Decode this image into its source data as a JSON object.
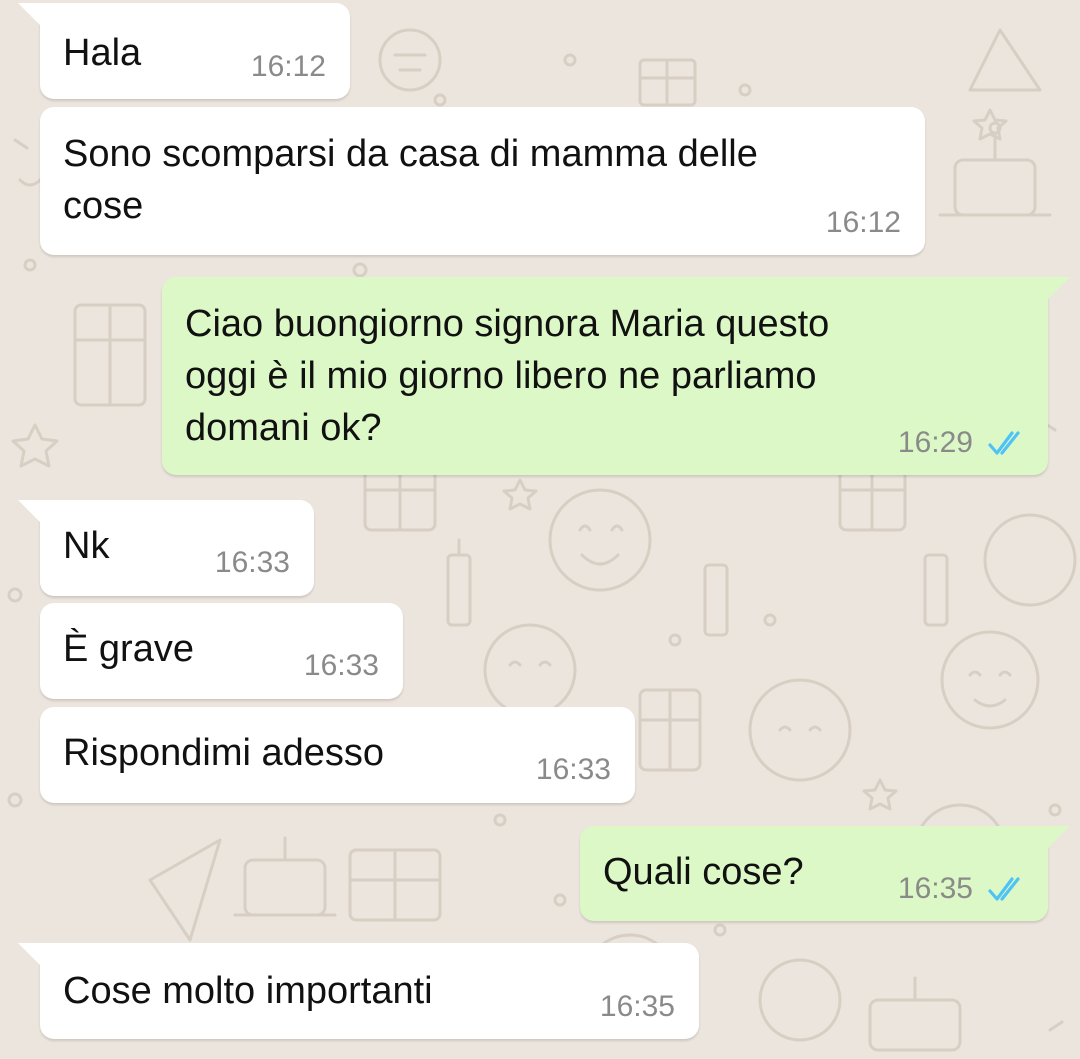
{
  "theme": {
    "incoming_bg": "#ffffff",
    "outgoing_bg": "#dcf8c6",
    "chat_bg": "#ece5dd",
    "read_tick_color": "#4fc3f7"
  },
  "messages": [
    {
      "direction": "incoming",
      "text": "Hala",
      "time": "16:12"
    },
    {
      "direction": "incoming",
      "text": "Sono scomparsi da casa di mamma delle\ncose",
      "time": "16:12"
    },
    {
      "direction": "outgoing",
      "text": "Ciao buongiorno signora Maria questo\noggi è il mio giorno libero ne parliamo\ndomani ok?",
      "time": "16:29",
      "status": "read",
      "status_icon": "double-check-icon"
    },
    {
      "direction": "incoming",
      "text": "Nk",
      "time": "16:33"
    },
    {
      "direction": "incoming",
      "text": "È grave",
      "time": "16:33"
    },
    {
      "direction": "incoming",
      "text": "Rispondimi adesso",
      "time": "16:33"
    },
    {
      "direction": "outgoing",
      "text": "Quali cose?",
      "time": "16:35",
      "status": "read",
      "status_icon": "double-check-icon"
    },
    {
      "direction": "incoming",
      "text": "Cose molto importanti",
      "time": "16:35"
    }
  ]
}
